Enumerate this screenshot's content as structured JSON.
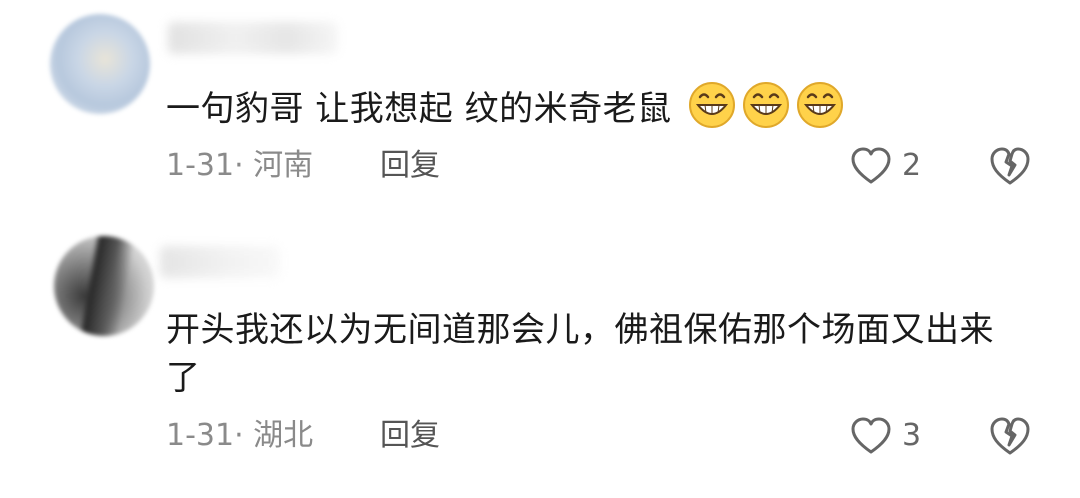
{
  "comments": [
    {
      "text": "一句豹哥 让我想起 纹的米奇老鼠",
      "emoji": [
        "grinning-face-icon",
        "grinning-face-icon",
        "grinning-face-icon"
      ],
      "meta": "1-31· 河南",
      "reply_label": "回复",
      "like_count": "2"
    },
    {
      "text": "开头我还以为无间道那会儿，佛祖保佑那个场面又出来了",
      "meta": "1-31· 湖北",
      "reply_label": "回复",
      "like_count": "3"
    }
  ],
  "colors": {
    "text": "#1a1a1a",
    "meta": "#8a8a8a",
    "icon": "#666666",
    "emoji_fill": "#ffd24a"
  }
}
